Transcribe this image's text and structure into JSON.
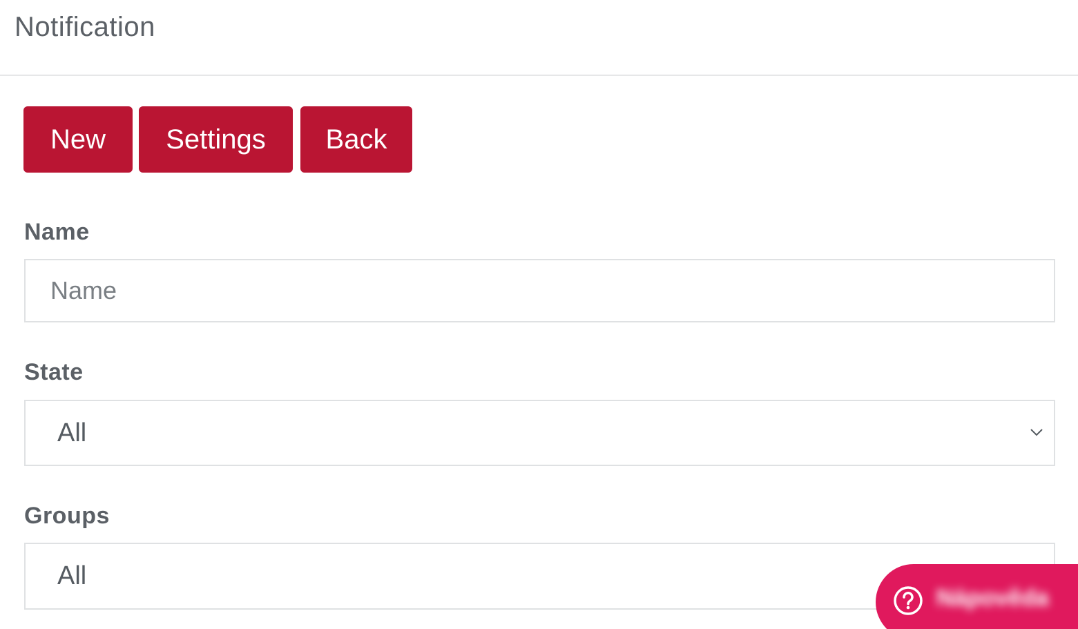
{
  "header": {
    "title": "Notification"
  },
  "toolbar": {
    "new_label": "New",
    "settings_label": "Settings",
    "back_label": "Back"
  },
  "form": {
    "name": {
      "label": "Name",
      "value": "",
      "placeholder": "Name"
    },
    "state": {
      "label": "State",
      "selected": "All"
    },
    "groups": {
      "label": "Groups",
      "selected": "All"
    }
  },
  "help_widget": {
    "icon": "question-circle-icon",
    "label": "Nápověda"
  },
  "colors": {
    "primary_button": "#ba1533",
    "help_widget": "#e0195d",
    "text": "#5b6066",
    "border": "#dfe1e3"
  }
}
